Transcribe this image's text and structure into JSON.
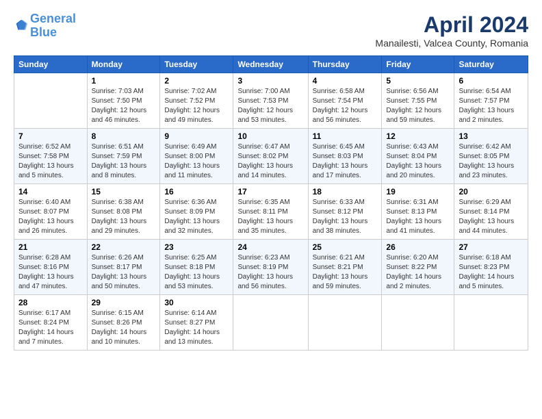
{
  "header": {
    "logo_line1": "General",
    "logo_line2": "Blue",
    "month": "April 2024",
    "location": "Manailesti, Valcea County, Romania"
  },
  "weekdays": [
    "Sunday",
    "Monday",
    "Tuesday",
    "Wednesday",
    "Thursday",
    "Friday",
    "Saturday"
  ],
  "weeks": [
    [
      {
        "day": "",
        "info": ""
      },
      {
        "day": "1",
        "info": "Sunrise: 7:03 AM\nSunset: 7:50 PM\nDaylight: 12 hours\nand 46 minutes."
      },
      {
        "day": "2",
        "info": "Sunrise: 7:02 AM\nSunset: 7:52 PM\nDaylight: 12 hours\nand 49 minutes."
      },
      {
        "day": "3",
        "info": "Sunrise: 7:00 AM\nSunset: 7:53 PM\nDaylight: 12 hours\nand 53 minutes."
      },
      {
        "day": "4",
        "info": "Sunrise: 6:58 AM\nSunset: 7:54 PM\nDaylight: 12 hours\nand 56 minutes."
      },
      {
        "day": "5",
        "info": "Sunrise: 6:56 AM\nSunset: 7:55 PM\nDaylight: 12 hours\nand 59 minutes."
      },
      {
        "day": "6",
        "info": "Sunrise: 6:54 AM\nSunset: 7:57 PM\nDaylight: 13 hours\nand 2 minutes."
      }
    ],
    [
      {
        "day": "7",
        "info": "Sunrise: 6:52 AM\nSunset: 7:58 PM\nDaylight: 13 hours\nand 5 minutes."
      },
      {
        "day": "8",
        "info": "Sunrise: 6:51 AM\nSunset: 7:59 PM\nDaylight: 13 hours\nand 8 minutes."
      },
      {
        "day": "9",
        "info": "Sunrise: 6:49 AM\nSunset: 8:00 PM\nDaylight: 13 hours\nand 11 minutes."
      },
      {
        "day": "10",
        "info": "Sunrise: 6:47 AM\nSunset: 8:02 PM\nDaylight: 13 hours\nand 14 minutes."
      },
      {
        "day": "11",
        "info": "Sunrise: 6:45 AM\nSunset: 8:03 PM\nDaylight: 13 hours\nand 17 minutes."
      },
      {
        "day": "12",
        "info": "Sunrise: 6:43 AM\nSunset: 8:04 PM\nDaylight: 13 hours\nand 20 minutes."
      },
      {
        "day": "13",
        "info": "Sunrise: 6:42 AM\nSunset: 8:05 PM\nDaylight: 13 hours\nand 23 minutes."
      }
    ],
    [
      {
        "day": "14",
        "info": "Sunrise: 6:40 AM\nSunset: 8:07 PM\nDaylight: 13 hours\nand 26 minutes."
      },
      {
        "day": "15",
        "info": "Sunrise: 6:38 AM\nSunset: 8:08 PM\nDaylight: 13 hours\nand 29 minutes."
      },
      {
        "day": "16",
        "info": "Sunrise: 6:36 AM\nSunset: 8:09 PM\nDaylight: 13 hours\nand 32 minutes."
      },
      {
        "day": "17",
        "info": "Sunrise: 6:35 AM\nSunset: 8:11 PM\nDaylight: 13 hours\nand 35 minutes."
      },
      {
        "day": "18",
        "info": "Sunrise: 6:33 AM\nSunset: 8:12 PM\nDaylight: 13 hours\nand 38 minutes."
      },
      {
        "day": "19",
        "info": "Sunrise: 6:31 AM\nSunset: 8:13 PM\nDaylight: 13 hours\nand 41 minutes."
      },
      {
        "day": "20",
        "info": "Sunrise: 6:29 AM\nSunset: 8:14 PM\nDaylight: 13 hours\nand 44 minutes."
      }
    ],
    [
      {
        "day": "21",
        "info": "Sunrise: 6:28 AM\nSunset: 8:16 PM\nDaylight: 13 hours\nand 47 minutes."
      },
      {
        "day": "22",
        "info": "Sunrise: 6:26 AM\nSunset: 8:17 PM\nDaylight: 13 hours\nand 50 minutes."
      },
      {
        "day": "23",
        "info": "Sunrise: 6:25 AM\nSunset: 8:18 PM\nDaylight: 13 hours\nand 53 minutes."
      },
      {
        "day": "24",
        "info": "Sunrise: 6:23 AM\nSunset: 8:19 PM\nDaylight: 13 hours\nand 56 minutes."
      },
      {
        "day": "25",
        "info": "Sunrise: 6:21 AM\nSunset: 8:21 PM\nDaylight: 13 hours\nand 59 minutes."
      },
      {
        "day": "26",
        "info": "Sunrise: 6:20 AM\nSunset: 8:22 PM\nDaylight: 14 hours\nand 2 minutes."
      },
      {
        "day": "27",
        "info": "Sunrise: 6:18 AM\nSunset: 8:23 PM\nDaylight: 14 hours\nand 5 minutes."
      }
    ],
    [
      {
        "day": "28",
        "info": "Sunrise: 6:17 AM\nSunset: 8:24 PM\nDaylight: 14 hours\nand 7 minutes."
      },
      {
        "day": "29",
        "info": "Sunrise: 6:15 AM\nSunset: 8:26 PM\nDaylight: 14 hours\nand 10 minutes."
      },
      {
        "day": "30",
        "info": "Sunrise: 6:14 AM\nSunset: 8:27 PM\nDaylight: 14 hours\nand 13 minutes."
      },
      {
        "day": "",
        "info": ""
      },
      {
        "day": "",
        "info": ""
      },
      {
        "day": "",
        "info": ""
      },
      {
        "day": "",
        "info": ""
      }
    ]
  ]
}
